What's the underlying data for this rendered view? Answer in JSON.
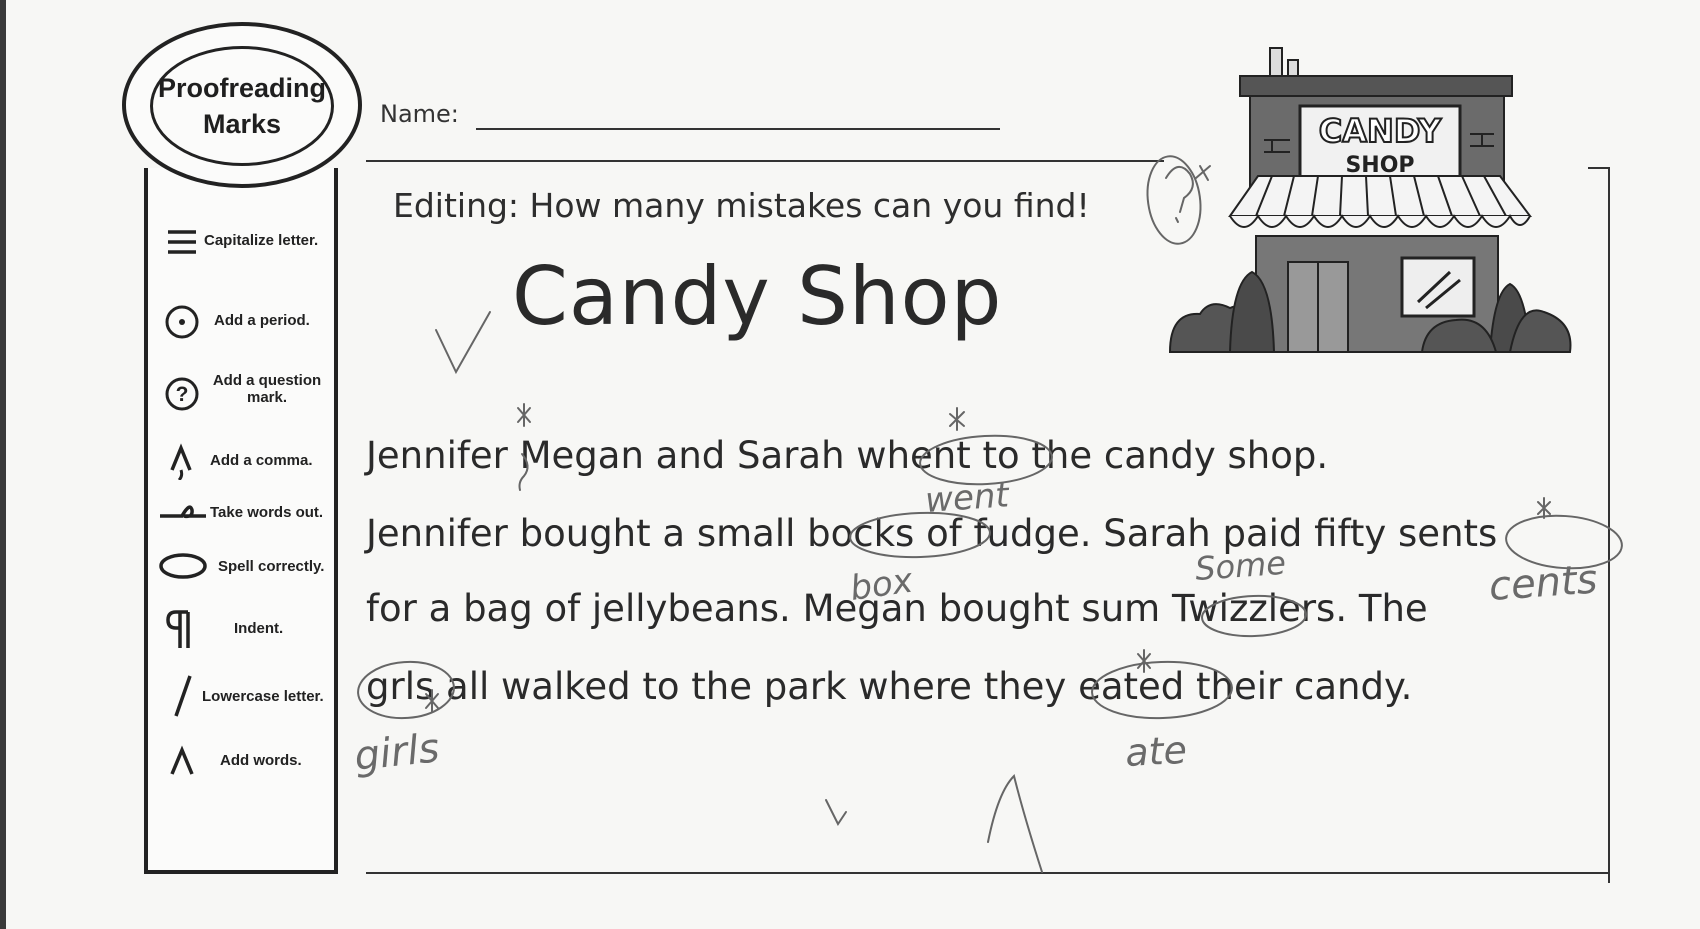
{
  "header": {
    "name_label": "Name:"
  },
  "sidebar": {
    "title": "Proofreading\nMarks",
    "items": [
      {
        "icon": "capitalize-mark-icon",
        "label": "Capitalize letter."
      },
      {
        "icon": "period-mark-icon",
        "label": "Add a period."
      },
      {
        "icon": "question-mark-icon",
        "label": "Add a question mark."
      },
      {
        "icon": "comma-mark-icon",
        "label": "Add a comma."
      },
      {
        "icon": "delete-mark-icon",
        "label": "Take words out."
      },
      {
        "icon": "spell-mark-icon",
        "label": "Spell correctly."
      },
      {
        "icon": "indent-mark-icon",
        "label": "Indent."
      },
      {
        "icon": "lowercase-mark-icon",
        "label": "Lowercase letter."
      },
      {
        "icon": "caret-mark-icon",
        "label": "Add words."
      }
    ]
  },
  "worksheet": {
    "prompt": "Editing:  How many mistakes can you find!",
    "title": "Candy Shop",
    "illustration_sign": {
      "line1": "CANDY",
      "line2": "SHOP"
    },
    "story_lines": [
      "Jennifer Megan and Sarah whent to the candy shop.",
      "Jennifer bought a small bocks of fudge.  Sarah paid fifty sents",
      "for a bag of jellybeans.   Megan bought sum Twizzlers.  The",
      "grls all walked to the park where they eated their candy."
    ]
  },
  "handwriting": {
    "corrections": [
      "went",
      "box",
      "Some",
      "cents",
      "girls",
      "ate"
    ]
  }
}
